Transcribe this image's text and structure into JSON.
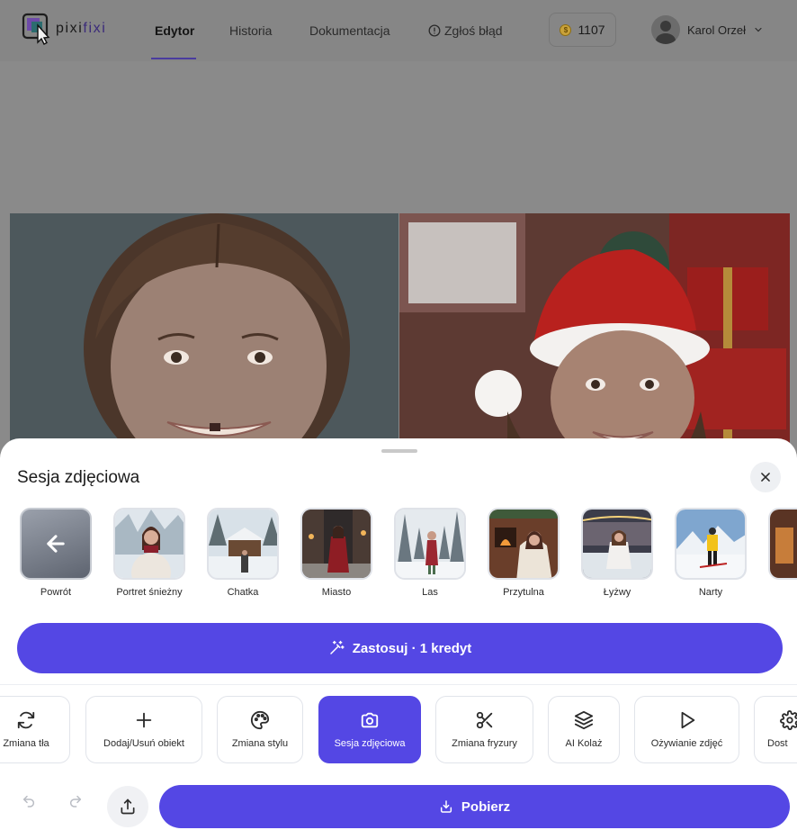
{
  "app": {
    "logo": {
      "text_dark": "pixi",
      "text_accent": "fixi"
    }
  },
  "nav": {
    "items": [
      {
        "label": "Edytor",
        "active": true
      },
      {
        "label": "Historia",
        "active": false
      },
      {
        "label": "Dokumentacja",
        "active": false
      },
      {
        "label": "Zgłoś błąd",
        "active": false,
        "icon": "alert-circle-icon"
      }
    ]
  },
  "credits": {
    "value": "1107",
    "icon": "coin-icon"
  },
  "user": {
    "name": "Karol Orzeł",
    "icon": "chevron-down-icon"
  },
  "sheet": {
    "title": "Sesja zdjęciowa",
    "close_icon": "close-icon",
    "presets": [
      {
        "label": "Powrót",
        "icon": "arrow-left-icon"
      },
      {
        "label": "Portret śnieżny"
      },
      {
        "label": "Chatka"
      },
      {
        "label": "Miasto"
      },
      {
        "label": "Las"
      },
      {
        "label": "Przytulna"
      },
      {
        "label": "Łyżwy"
      },
      {
        "label": "Narty"
      }
    ],
    "apply_label": "Zastosuj · 1 kredyt",
    "apply_icon": "magic-wand-icon"
  },
  "tools": [
    {
      "label": "Zmiana tła",
      "icon": "refresh-icon",
      "active": false
    },
    {
      "label": "Dodaj/Usuń obiekt",
      "icon": "plus-icon",
      "active": false
    },
    {
      "label": "Zmiana stylu",
      "icon": "palette-icon",
      "active": false
    },
    {
      "label": "Sesja zdjęciowa",
      "icon": "camera-icon",
      "active": true
    },
    {
      "label": "Zmiana fryzury",
      "icon": "scissors-icon",
      "active": false
    },
    {
      "label": "AI Kolaż",
      "icon": "layers-icon",
      "active": false
    },
    {
      "label": "Ożywianie zdjęć",
      "icon": "play-icon",
      "active": false
    },
    {
      "label": "Dost",
      "icon": "gear-icon",
      "active": false
    }
  ],
  "actions": {
    "download_label": "Pobierz",
    "download_icon": "download-icon"
  },
  "colors": {
    "accent": "#5447e4",
    "overlay": "#8a8a8a"
  }
}
